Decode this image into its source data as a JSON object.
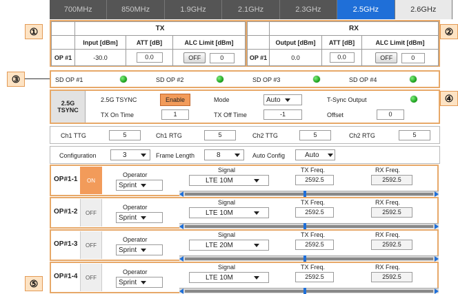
{
  "tabs": [
    "700MHz",
    "850MHz",
    "1.9GHz",
    "2.1GHz",
    "2.3GHz",
    "2.5GHz",
    "2.6GHz"
  ],
  "callouts": [
    "①",
    "②",
    "③",
    "④",
    "⑤"
  ],
  "tx": {
    "title": "TX",
    "headers": [
      "Input [dBm]",
      "ATT [dB]",
      "ALC Limit [dBm]"
    ],
    "op_label": "OP #1",
    "input": "-30.0",
    "att": "0.0",
    "alc_btn": "OFF",
    "alc_value": "0"
  },
  "rx": {
    "title": "RX",
    "headers": [
      "Output [dBm]",
      "ATT [dB]",
      "ALC Limit [dBm]"
    ],
    "op_label": "OP #1",
    "output": "0.0",
    "att": "0.0",
    "alc_btn": "OFF",
    "alc_value": "0"
  },
  "sd": [
    "SD OP #1",
    "SD OP #2",
    "SD OP #3",
    "SD OP #4"
  ],
  "tsync": {
    "label1": "2.5G",
    "label2": "TSYNC",
    "tsync_label": "2.5G TSYNC",
    "enable": "Enable",
    "mode_label": "Mode",
    "mode_value": "Auto",
    "output_label": "T-Sync Output",
    "tx_on_label": "TX On Time",
    "tx_on_value": "1",
    "tx_off_label": "TX Off Time",
    "tx_off_value": "-1",
    "offset_label": "Offset",
    "offset_value": "0"
  },
  "ttg": [
    {
      "label": "Ch1 TTG",
      "value": "5"
    },
    {
      "label": "Ch1 RTG",
      "value": "5"
    },
    {
      "label": "Ch2 TTG",
      "value": "5"
    },
    {
      "label": "Ch2 RTG",
      "value": "5"
    }
  ],
  "config": {
    "config_label": "Configuration",
    "config_value": "3",
    "frame_label": "Frame Length",
    "frame_value": "8",
    "auto_label": "Auto Config",
    "auto_value": "Auto"
  },
  "op_rows": [
    {
      "name": "OP#1-1",
      "state": "ON",
      "operator_label": "Operator",
      "operator": "Sprint",
      "signal_label": "Signal",
      "signal": "LTE 10M",
      "txf_label": "TX Freq.",
      "txf": "2592.5",
      "rxf_label": "RX Freq.",
      "rxf": "2592.5"
    },
    {
      "name": "OP#1-2",
      "state": "OFF",
      "operator_label": "Operator",
      "operator": "Sprint",
      "signal_label": "Signal",
      "signal": "LTE 10M",
      "txf_label": "TX Freq.",
      "txf": "2592.5",
      "rxf_label": "RX Freq.",
      "rxf": "2592.5"
    },
    {
      "name": "OP#1-3",
      "state": "OFF",
      "operator_label": "Operator",
      "operator": "Sprint",
      "signal_label": "Signal",
      "signal": "LTE 20M",
      "txf_label": "TX Freq.",
      "txf": "2592.5",
      "rxf_label": "RX Freq.",
      "rxf": "2592.5"
    },
    {
      "name": "OP#1-4",
      "state": "OFF",
      "operator_label": "Operator",
      "operator": "Sprint",
      "signal_label": "Signal",
      "signal": "LTE 10M",
      "txf_label": "TX Freq.",
      "txf": "2592.5",
      "rxf_label": "RX Freq.",
      "rxf": "2592.5"
    }
  ],
  "colors": {
    "accent": "#1f6fd8",
    "callout_border": "#e7a868",
    "led": "#22aa22",
    "on": "#f29b5a"
  }
}
